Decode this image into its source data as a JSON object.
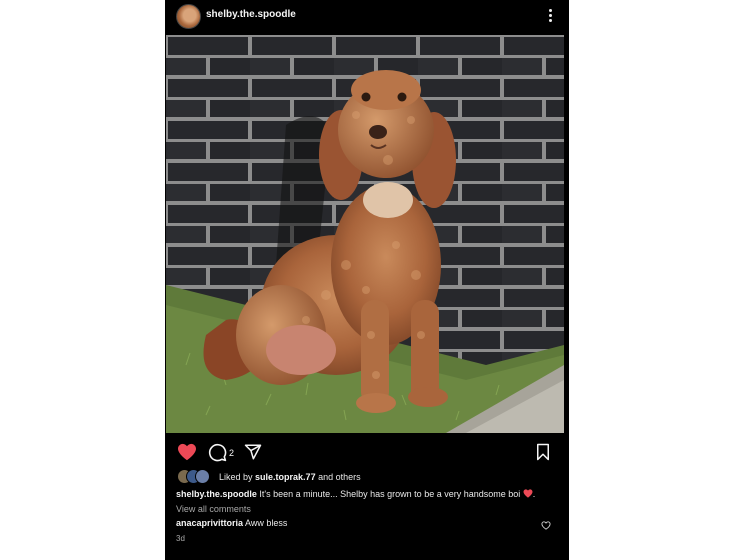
{
  "post": {
    "username": "shelby.the.spoodle",
    "likes": {
      "prefix": "Liked by",
      "user": "sule.toprak.77",
      "suffix": "and others"
    },
    "comment_count": "2",
    "caption": {
      "username": "shelby.the.spoodle",
      "text": "It's been a minute... Shelby has grown to be a very handsome boi"
    },
    "view_all_label": "View all comments",
    "top_comment": {
      "username": "anacaprivittoria",
      "text": "Aww bless"
    },
    "timestamp": "3d"
  },
  "colors": {
    "background": "#000000",
    "like_red": "#ed4956",
    "text": "#f5f5f5",
    "muted": "#a8a8a8"
  },
  "icons": {
    "post_more": "more-vertical-icon",
    "like": "heart-filled-icon",
    "comment": "comment-bubble-icon",
    "share": "paper-plane-icon",
    "save": "bookmark-icon",
    "comment_like": "heart-outline-icon"
  }
}
